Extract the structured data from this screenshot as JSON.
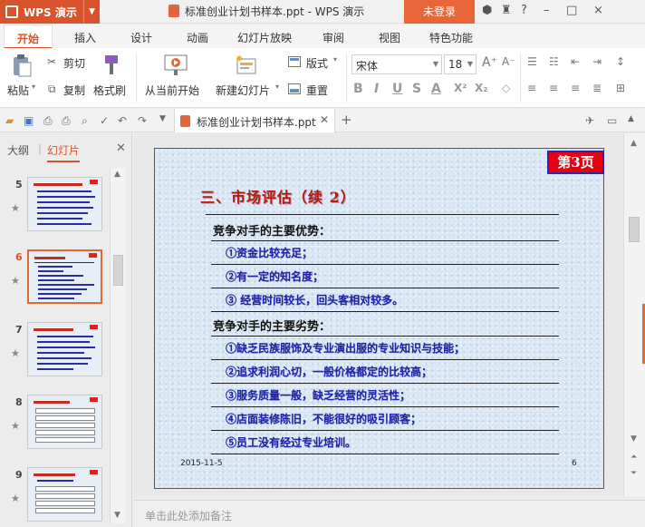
{
  "app": {
    "name": "WPS 演示",
    "document_title": "标准创业计划书样本.ppt - WPS 演示",
    "login_label": "未登录",
    "window_controls": [
      "?",
      "–",
      "□",
      "×"
    ]
  },
  "menu": {
    "tabs": [
      "开始",
      "插入",
      "设计",
      "动画",
      "幻灯片放映",
      "审阅",
      "视图",
      "特色功能"
    ],
    "active_tab": "开始"
  },
  "ribbon": {
    "paste_label": "粘贴",
    "cut_label": "剪切",
    "copy_label": "复制",
    "format_painter_label": "格式刷",
    "from_current_label": "从当前开始",
    "new_slide_label": "新建幻灯片",
    "layout_label": "版式",
    "reset_label": "重置",
    "font_name": "宋体",
    "font_size": "18",
    "font_buttons": [
      "B",
      "I",
      "U",
      "S",
      "A",
      "X²",
      "X₂"
    ]
  },
  "doc_tab": {
    "label": "标准创业计划书样本.ppt"
  },
  "panel": {
    "tabs": [
      "大纲",
      "幻灯片"
    ],
    "active_tab": "幻灯片",
    "thumbnails": [
      {
        "num": "5",
        "kind": "text"
      },
      {
        "num": "6",
        "kind": "text",
        "selected": true
      },
      {
        "num": "7",
        "kind": "text"
      },
      {
        "num": "8",
        "kind": "table"
      },
      {
        "num": "9",
        "kind": "table"
      }
    ]
  },
  "slide": {
    "page_badge": "第3页",
    "title": "三、市场评估（续 2）",
    "advantages_heading": "竞争对手的主要优势：",
    "advantages": [
      "①资金比较充足；",
      "②有一定的知名度；",
      "③ 经营时间较长，回头客相对较多。"
    ],
    "disadvantages_heading": "竞争对手的主要劣势：",
    "disadvantages": [
      "①缺乏民族服饰及专业演出服的专业知识与技能；",
      "②追求利润心切，一般价格都定的比较高；",
      "③服务质量一般，缺乏经营的灵活性；",
      "④店面装修陈旧，不能很好的吸引顾客；",
      "⑤员工没有经过专业培训。"
    ],
    "date": "2015-11-5",
    "number": "6"
  },
  "notes": {
    "placeholder": "单击此处添加备注"
  },
  "colors": {
    "brand": "#d9532c",
    "title_red": "#b31a14",
    "item_blue": "#1e22a8",
    "slide_bg": "#d9e7f4"
  }
}
